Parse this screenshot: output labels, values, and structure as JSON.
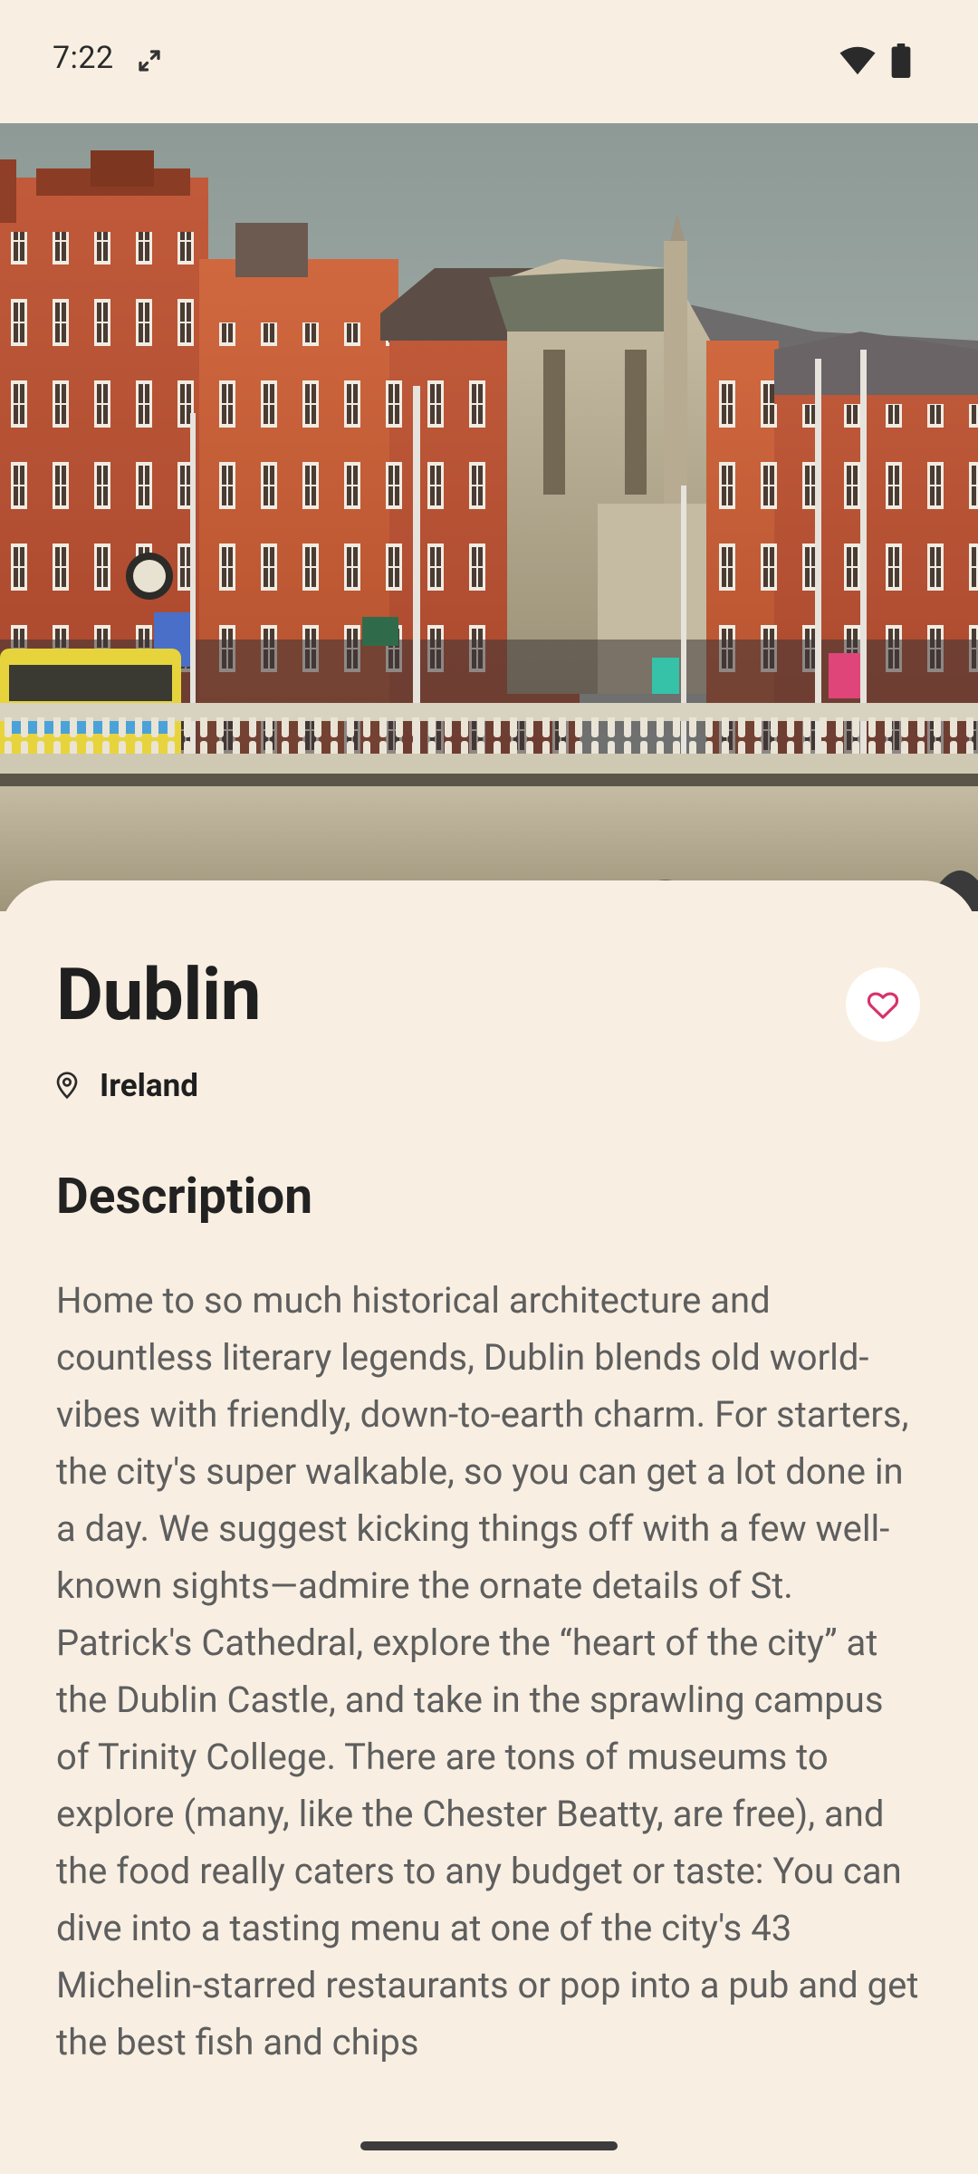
{
  "status_bar": {
    "time": "7:22",
    "icons": [
      "sync-icon",
      "wifi-icon",
      "battery-icon"
    ]
  },
  "hero": {
    "image": "dublin-riverside-buildings-photo"
  },
  "destination": {
    "title": "Dublin",
    "country": "Ireland",
    "favorite_icon": "heart-outline-icon",
    "location_icon": "location-pin-icon"
  },
  "description": {
    "heading": "Description",
    "text": "Home to so much historical architecture and countless literary legends, Dublin blends old world-vibes with friendly, down-to-earth charm. For starters, the city's super walkable, so you can get a lot done in a day. We suggest kicking things off with a few well-known sights—admire the ornate details of St. Patrick's Cathedral, explore the “heart of the city” at the Dublin Castle, and take in the sprawling campus of Trinity College. There are tons of museums to explore (many, like the Chester Beatty, are free), and the food really caters to any budget or taste: You can dive into a tasting menu at one of the city's 43 Michelin-starred restaurants or pop into a pub and get the best fish and chips"
  },
  "colors": {
    "background": "#f8efe2",
    "accent": "#d6336c",
    "text_primary": "#1f1f1f",
    "text_secondary": "#5e5e5e"
  }
}
